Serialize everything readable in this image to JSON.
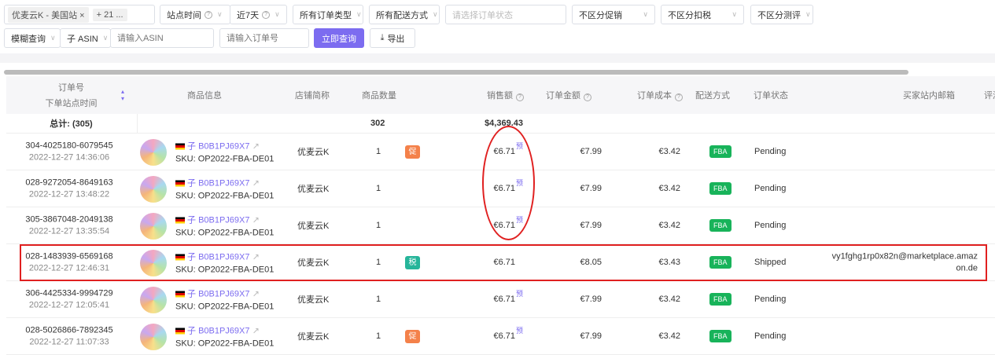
{
  "filters": {
    "store_tag": "优麦云K - 美国站",
    "more_tag": "+ 21 ...",
    "time_type": "站点时间",
    "time_range": "近7天",
    "order_type": "所有订单类型",
    "delivery": "所有配送方式",
    "status_placeholder": "请选择订单状态",
    "promo": "不区分促销",
    "tax": "不区分扣税",
    "review": "不区分测评",
    "search_mode": "模糊查询",
    "asin_type": "子 ASIN",
    "asin_placeholder": "请输入ASIN",
    "order_placeholder": "请输入订单号",
    "query_button": "立即查询",
    "export_button": "导出"
  },
  "table": {
    "headers": {
      "order": "订单号",
      "order_time": "下单站点时间",
      "product": "商品信息",
      "store": "店铺简称",
      "qty": "商品数量",
      "sales": "销售额",
      "order_amount": "订单金额",
      "cost": "订单成本",
      "delivery": "配送方式",
      "status": "订单状态",
      "email": "买家站内邮箱",
      "review": "评测"
    },
    "total": {
      "label": "总计: (305)",
      "qty": "302",
      "sales": "$4,369.43"
    },
    "rows": [
      {
        "order": "304-4025180-6079545",
        "time": "2022-12-27 14:36:06",
        "asin_prefix": "子",
        "asin": "B0B1PJ69X7",
        "sku": "SKU: OP2022-FBA-DE01",
        "store": "优麦云K",
        "qty": "1",
        "badge": "促",
        "badge_color": "#f4814a",
        "sales": "€6.71",
        "pre": "预",
        "amount": "€7.99",
        "cost": "€3.42",
        "delivery": "FBA",
        "status": "Pending",
        "email": ""
      },
      {
        "order": "028-9272054-8649163",
        "time": "2022-12-27 13:48:22",
        "asin_prefix": "子",
        "asin": "B0B1PJ69X7",
        "sku": "SKU: OP2022-FBA-DE01",
        "store": "优麦云K",
        "qty": "1",
        "badge": "",
        "badge_color": "",
        "sales": "€6.71",
        "pre": "预",
        "amount": "€7.99",
        "cost": "€3.42",
        "delivery": "FBA",
        "status": "Pending",
        "email": ""
      },
      {
        "order": "305-3867048-2049138",
        "time": "2022-12-27 13:35:54",
        "asin_prefix": "子",
        "asin": "B0B1PJ69X7",
        "sku": "SKU: OP2022-FBA-DE01",
        "store": "优麦云K",
        "qty": "1",
        "badge": "",
        "badge_color": "",
        "sales": "€6.71",
        "pre": "预",
        "amount": "€7.99",
        "cost": "€3.42",
        "delivery": "FBA",
        "status": "Pending",
        "email": ""
      },
      {
        "order": "028-1483939-6569168",
        "time": "2022-12-27 12:46:31",
        "asin_prefix": "子",
        "asin": "B0B1PJ69X7",
        "sku": "SKU: OP2022-FBA-DE01",
        "store": "优麦云K",
        "qty": "1",
        "badge": "税",
        "badge_color": "#26b59a",
        "sales": "€6.71",
        "pre": "",
        "amount": "€8.05",
        "cost": "€3.43",
        "delivery": "FBA",
        "status": "Shipped",
        "email": "vy1fghg1rp0x82n@marketplace.amaz",
        "email2": "on.de"
      },
      {
        "order": "306-4425334-9994729",
        "time": "2022-12-27 12:05:41",
        "asin_prefix": "子",
        "asin": "B0B1PJ69X7",
        "sku": "SKU: OP2022-FBA-DE01",
        "store": "优麦云K",
        "qty": "1",
        "badge": "",
        "badge_color": "",
        "sales": "€6.71",
        "pre": "预",
        "amount": "€7.99",
        "cost": "€3.42",
        "delivery": "FBA",
        "status": "Pending",
        "email": ""
      },
      {
        "order": "028-5026866-7892345",
        "time": "2022-12-27 11:07:33",
        "asin_prefix": "子",
        "asin": "B0B1PJ69X7",
        "sku": "SKU: OP2022-FBA-DE01",
        "store": "优麦云K",
        "qty": "1",
        "badge": "促",
        "badge_color": "#f4814a",
        "sales": "€6.71",
        "pre": "预",
        "amount": "€7.99",
        "cost": "€3.42",
        "delivery": "FBA",
        "status": "Pending",
        "email": ""
      }
    ]
  }
}
